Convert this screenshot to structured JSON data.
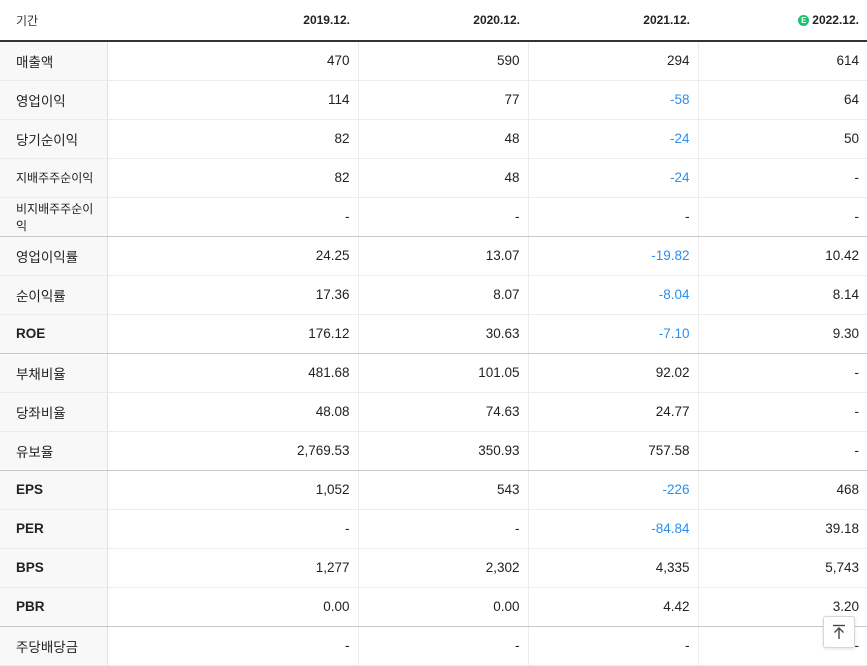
{
  "header": {
    "label": "기간",
    "periods": [
      "2019.12.",
      "2020.12.",
      "2021.12.",
      "2022.12."
    ],
    "estimate_badge": "E"
  },
  "rows": [
    {
      "label": "매출액",
      "values": [
        "470",
        "590",
        "294",
        "614"
      ]
    },
    {
      "label": "영업이익",
      "values": [
        "114",
        "77",
        "-58",
        "64"
      ]
    },
    {
      "label": "당기순이익",
      "values": [
        "82",
        "48",
        "-24",
        "50"
      ]
    },
    {
      "label": "지배주주순이익",
      "values": [
        "82",
        "48",
        "-24",
        "-"
      ]
    },
    {
      "label": "비지배주주순이익",
      "values": [
        "-",
        "-",
        "-",
        "-"
      ]
    },
    {
      "label": "영업이익률",
      "values": [
        "24.25",
        "13.07",
        "-19.82",
        "10.42"
      ]
    },
    {
      "label": "순이익률",
      "values": [
        "17.36",
        "8.07",
        "-8.04",
        "8.14"
      ]
    },
    {
      "label": "ROE",
      "values": [
        "176.12",
        "30.63",
        "-7.10",
        "9.30"
      ]
    },
    {
      "label": "부채비율",
      "values": [
        "481.68",
        "101.05",
        "92.02",
        "-"
      ]
    },
    {
      "label": "당좌비율",
      "values": [
        "48.08",
        "74.63",
        "24.77",
        "-"
      ]
    },
    {
      "label": "유보율",
      "values": [
        "2,769.53",
        "350.93",
        "757.58",
        "-"
      ]
    },
    {
      "label": "EPS",
      "values": [
        "1,052",
        "543",
        "-226",
        "468"
      ]
    },
    {
      "label": "PER",
      "values": [
        "-",
        "-",
        "-84.84",
        "39.18"
      ]
    },
    {
      "label": "BPS",
      "values": [
        "1,277",
        "2,302",
        "4,335",
        "5,743"
      ]
    },
    {
      "label": "PBR",
      "values": [
        "0.00",
        "0.00",
        "4.42",
        "3.20"
      ]
    },
    {
      "label": "주당배당금",
      "values": [
        "-",
        "-",
        "-",
        "-"
      ]
    }
  ],
  "colors": {
    "negative": "#2b8ff0",
    "estimate_badge": "#1fbf6f",
    "label_bg": "#f8f8f8"
  },
  "icons": {
    "scroll_top": "arrow-up-to-line-icon"
  }
}
